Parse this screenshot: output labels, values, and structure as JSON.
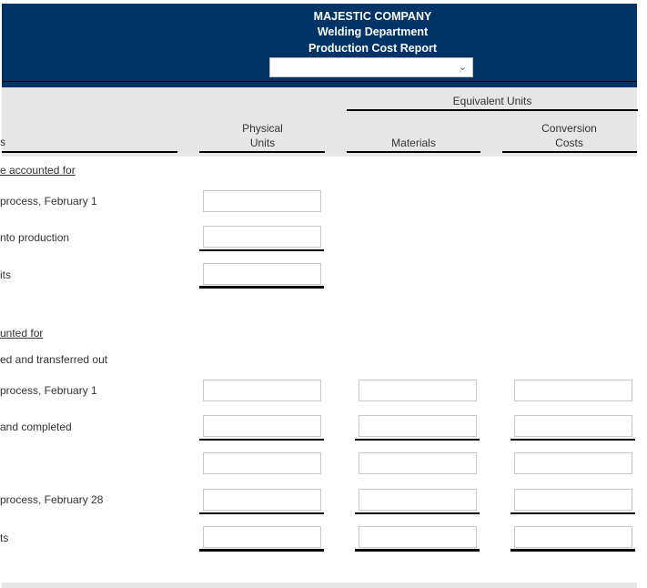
{
  "header": {
    "company": "MAJESTIC COMPANY",
    "department": "Welding Department",
    "report_title": "Production Cost Report",
    "period_select": {
      "selected": "",
      "options": []
    }
  },
  "columns": {
    "label_col": "s",
    "physical_units": [
      "Physical",
      "Units"
    ],
    "equivalent_units": "Equivalent Units",
    "materials": "Materials",
    "conversion_costs": [
      "Conversion",
      "Costs"
    ]
  },
  "sections": {
    "to_be_accounted": {
      "heading": "e accounted for",
      "rows": [
        {
          "label": "process, February 1",
          "physical": ""
        },
        {
          "label": "nto production",
          "physical": ""
        },
        {
          "label": "its",
          "physical": ""
        }
      ]
    },
    "accounted_for": {
      "heading": "unted for",
      "subheading": "ed and transferred out",
      "rows": [
        {
          "label": "process, February 1",
          "physical": "",
          "materials": "",
          "conversion": ""
        },
        {
          "label": "and completed",
          "physical": "",
          "materials": "",
          "conversion": ""
        },
        {
          "label": "",
          "physical": "",
          "materials": "",
          "conversion": ""
        },
        {
          "label": "process, February 28",
          "physical": "",
          "materials": "",
          "conversion": ""
        },
        {
          "label": "ts",
          "physical": "",
          "materials": "",
          "conversion": ""
        }
      ]
    }
  },
  "colors": {
    "header_bg": "#003366",
    "column_header_bg": "#e6e6e6"
  }
}
